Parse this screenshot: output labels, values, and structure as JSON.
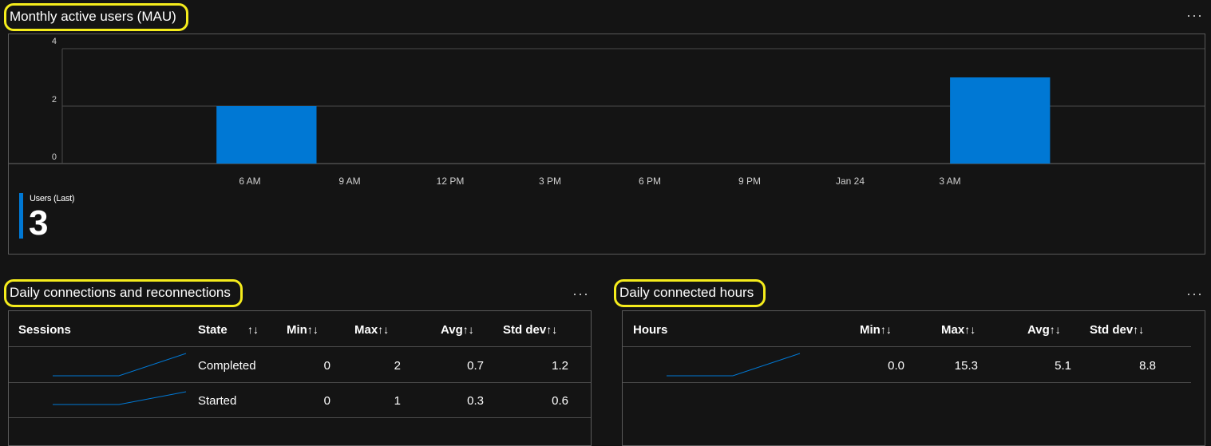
{
  "colors": {
    "accent": "#0078d4",
    "highlight": "#f5ec1c",
    "background": "#141414"
  },
  "more_icon": "ellipsis-icon",
  "more_glyph": "···",
  "mau": {
    "title": "Monthly active users (MAU)",
    "summary": {
      "label": "Users (Last)",
      "value": "3"
    },
    "chart_data": {
      "type": "bar",
      "title": "",
      "xlabel": "",
      "ylabel": "",
      "ylim": [
        0,
        4
      ],
      "y_ticks": [
        "4",
        "2",
        "0"
      ],
      "x_ticks": [
        "6 AM",
        "9 AM",
        "12 PM",
        "3 PM",
        "6 PM",
        "9 PM",
        "Jan 24",
        "3 AM"
      ],
      "series": [
        {
          "values": [
            {
              "start": "5:00 AM",
              "end": "8:00 AM",
              "value": 2
            },
            {
              "start": "3:00 AM",
              "end": "6:00 AM",
              "value": 3,
              "day": "Jan 24"
            }
          ]
        }
      ],
      "grid": true,
      "legend": "bottom-left"
    }
  },
  "connections": {
    "title": "Daily connections and reconnections",
    "headers": {
      "sessions": "Sessions",
      "state": "State",
      "min": "Min",
      "max": "Max",
      "avg": "Avg",
      "std": "Std dev",
      "sort": "↑↓"
    },
    "rows": [
      {
        "state": "Completed",
        "min": "0",
        "max": "2",
        "avg": "0.7",
        "std": "1.2"
      },
      {
        "state": "Started",
        "min": "0",
        "max": "1",
        "avg": "0.3",
        "std": "0.6"
      }
    ]
  },
  "hours": {
    "title": "Daily connected hours",
    "headers": {
      "hours": "Hours",
      "min": "Min",
      "max": "Max",
      "avg": "Avg",
      "std": "Std dev",
      "sort": "↑↓"
    },
    "rows": [
      {
        "min": "0.0",
        "max": "15.3",
        "avg": "5.1",
        "std": "8.8"
      }
    ]
  }
}
